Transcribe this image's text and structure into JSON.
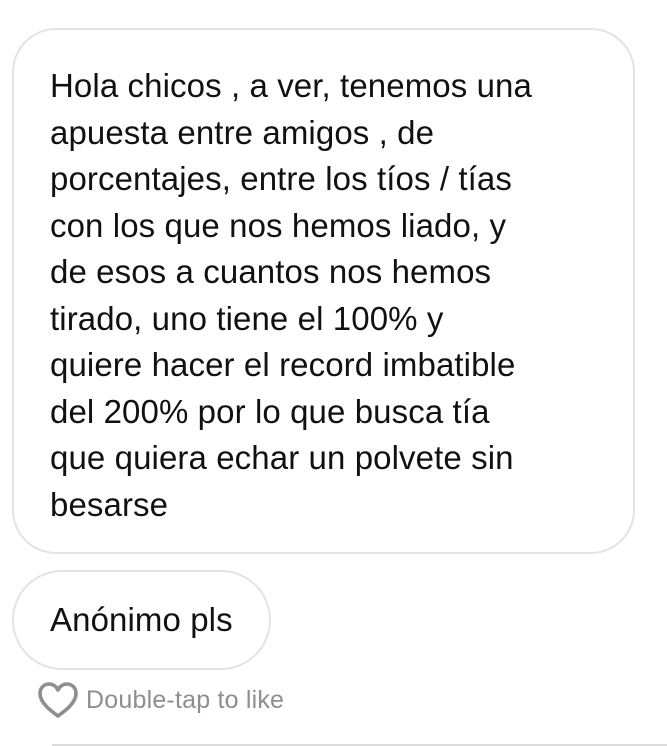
{
  "messages": [
    {
      "text": "Hola chicos , a ver, tenemos una\napuesta entre amigos , de\nporcentajes, entre los tíos / tías\ncon los que nos hemos liado, y\nde esos a cuantos nos hemos\ntirado, uno tiene el 100% y\nquiere hacer el record imbatible\ndel 200% por lo que busca tía\nque quiera echar un polvete sin\nbesarse"
    },
    {
      "text": "Anónimo pls"
    }
  ],
  "like": {
    "icon": "heart-outline-icon",
    "label": "Double-tap to like"
  },
  "colors": {
    "bubble_border": "#e3e3e3",
    "text": "#111111",
    "muted_text": "#8e8e8e",
    "divider": "#dbdbdb"
  }
}
